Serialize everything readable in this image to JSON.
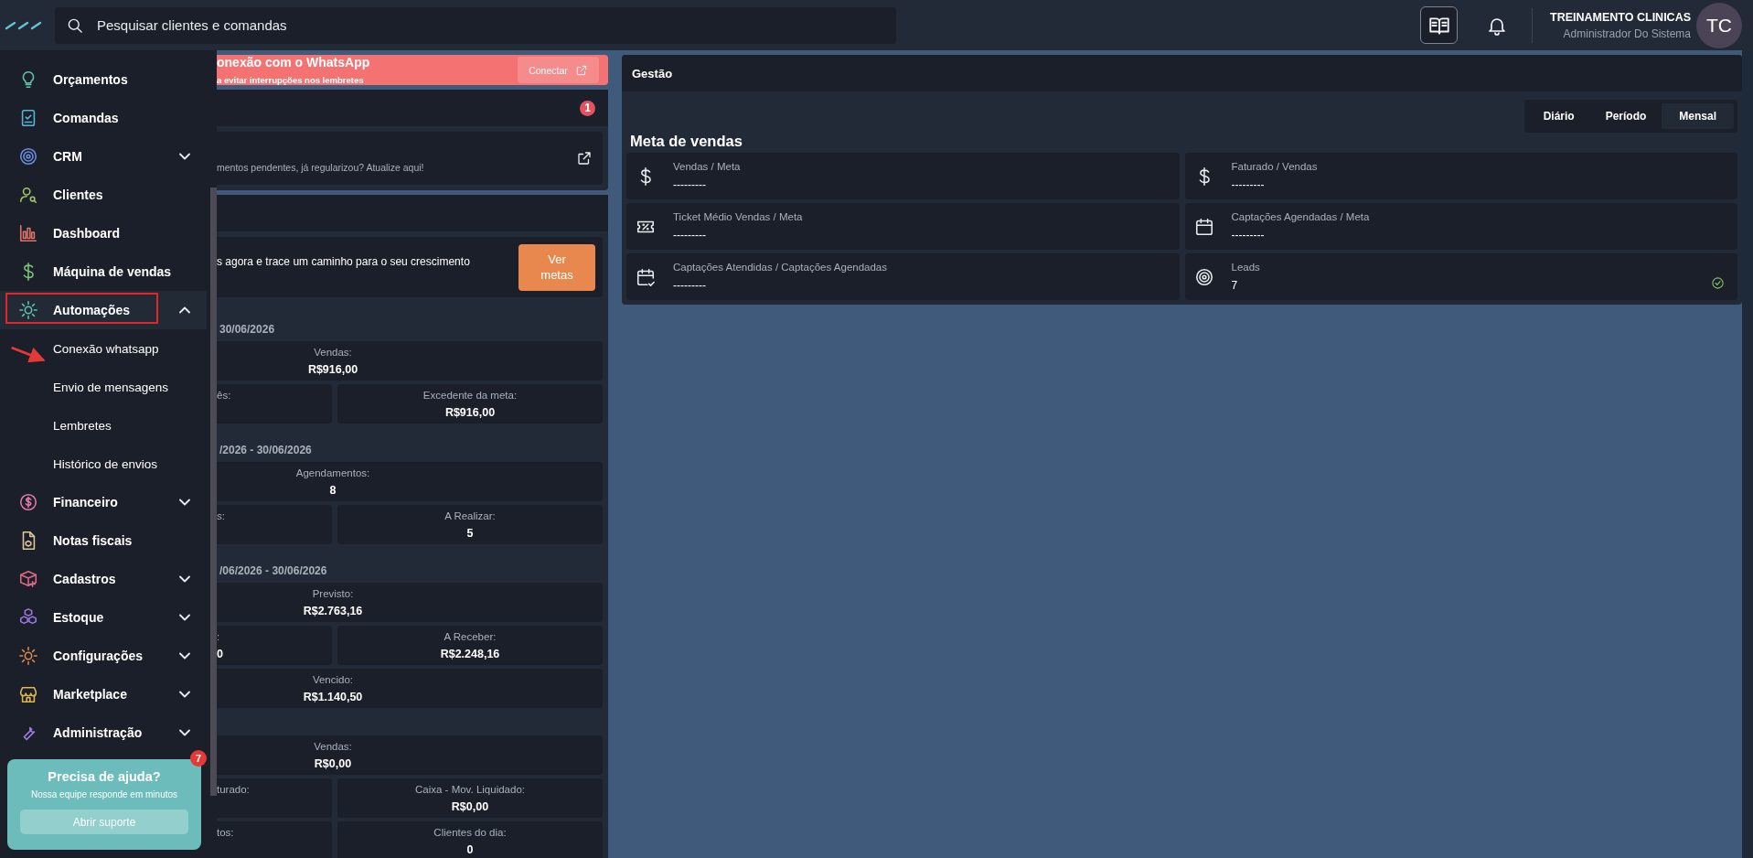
{
  "topbar": {
    "search": {
      "placeholder": "Pesquisar clientes e comandas"
    },
    "user": {
      "name": "TREINAMENTO CLINICAS",
      "role": "Administrador Do Sistema",
      "initials": "TC"
    }
  },
  "sidebar": {
    "items": [
      {
        "label": "Orçamentos",
        "selected": false,
        "annotated": false
      },
      {
        "label": "Comandas",
        "selected": false,
        "annotated": false
      },
      {
        "label": "CRM",
        "selected": false,
        "annotated": false,
        "expanded": false
      },
      {
        "label": "Clientes",
        "selected": false,
        "annotated": false
      },
      {
        "label": "Dashboard",
        "selected": false,
        "annotated": false
      },
      {
        "label": "Máquina de vendas",
        "selected": false,
        "annotated": false
      },
      {
        "label": "Automações",
        "selected": true,
        "annotated": true,
        "expanded": true,
        "children": [
          {
            "label": "Conexão whatsapp",
            "annotated": true
          },
          {
            "label": "Envio de mensagens",
            "annotated": false
          },
          {
            "label": "Lembretes",
            "annotated": false
          },
          {
            "label": "Histórico de envios",
            "annotated": false
          }
        ]
      },
      {
        "label": "Financeiro",
        "selected": false,
        "annotated": false,
        "expanded": false
      },
      {
        "label": "Notas fiscais",
        "selected": false,
        "annotated": false
      },
      {
        "label": "Cadastros",
        "selected": false,
        "annotated": false,
        "expanded": false
      },
      {
        "label": "Estoque",
        "selected": false,
        "annotated": false,
        "expanded": false
      },
      {
        "label": "Configurações",
        "selected": false,
        "annotated": false,
        "expanded": false
      },
      {
        "label": "Marketplace",
        "selected": false,
        "annotated": false,
        "expanded": false
      },
      {
        "label": "Administração",
        "selected": false,
        "annotated": false,
        "expanded": false
      }
    ],
    "help": {
      "title": "Precisa de ajuda?",
      "text": "Nossa equipe responde em minutos",
      "button": "Abrir suporte",
      "badge": "7"
    }
  },
  "middle": {
    "banner": {
      "title": "onexão com o WhatsApp",
      "subtitle": "a evitar interrupções nos lembretes",
      "button": "Conectar"
    },
    "notice": {
      "badge": "1",
      "text": "mentos pendentes, já regularizou? Atualize aqui!"
    },
    "goals": {
      "text": "s agora e trace um caminho para o seu crescimento",
      "button": "Ver metas"
    },
    "sections": [
      {
        "date": "30/06/2026",
        "boxes": [
          {
            "kind": "full",
            "label": "Vendas:",
            "value": "R$916,00"
          },
          {
            "kind": "left",
            "label": "ês:"
          },
          {
            "kind": "right",
            "label": "Excedente da meta:",
            "value": "R$916,00"
          }
        ]
      },
      {
        "date": "/2026 - 30/06/2026",
        "boxes": [
          {
            "kind": "full",
            "label": "Agendamentos:",
            "value": "8"
          },
          {
            "kind": "left",
            "label": "s:"
          },
          {
            "kind": "right",
            "label": "A Realizar:",
            "value": "5"
          }
        ]
      },
      {
        "date": "/06/2026 - 30/06/2026",
        "boxes": [
          {
            "kind": "full",
            "label": "Previsto:",
            "value": "R$2.763,16"
          },
          {
            "kind": "left",
            "label": ":",
            "value": "0"
          },
          {
            "kind": "right",
            "label": "A Receber:",
            "value": "R$2.248,16"
          },
          {
            "kind": "full",
            "label": "Vencido:",
            "value": "R$1.140,50"
          }
        ]
      },
      {
        "boxes": [
          {
            "kind": "full",
            "label": "Vendas:",
            "value": "R$0,00"
          },
          {
            "kind": "left",
            "label": "turado:"
          },
          {
            "kind": "right",
            "label": "Caixa - Mov. Liquidado:",
            "value": "R$0,00"
          },
          {
            "kind": "left",
            "label": "tos:"
          },
          {
            "kind": "right",
            "label": "Clientes do dia:",
            "value": "0"
          }
        ]
      }
    ]
  },
  "gestao": {
    "title": "Gestão",
    "tabs": [
      {
        "label": "Diário",
        "selected": false
      },
      {
        "label": "Período",
        "selected": false
      },
      {
        "label": "Mensal",
        "selected": true
      }
    ],
    "heading": "Meta de vendas",
    "cards": [
      {
        "label": "Vendas / Meta",
        "value": "---------",
        "done": false
      },
      {
        "label": "Faturado / Vendas",
        "value": "---------",
        "done": false
      },
      {
        "label": "Ticket Médio Vendas / Meta",
        "value": "---------",
        "done": false
      },
      {
        "label": "Captações Agendadas / Meta",
        "value": "---------",
        "done": false
      },
      {
        "label": "Captações Atendidas / Captações Agendadas",
        "value": "---------",
        "done": false
      },
      {
        "label": "Leads",
        "value": "7",
        "done": true
      }
    ]
  }
}
